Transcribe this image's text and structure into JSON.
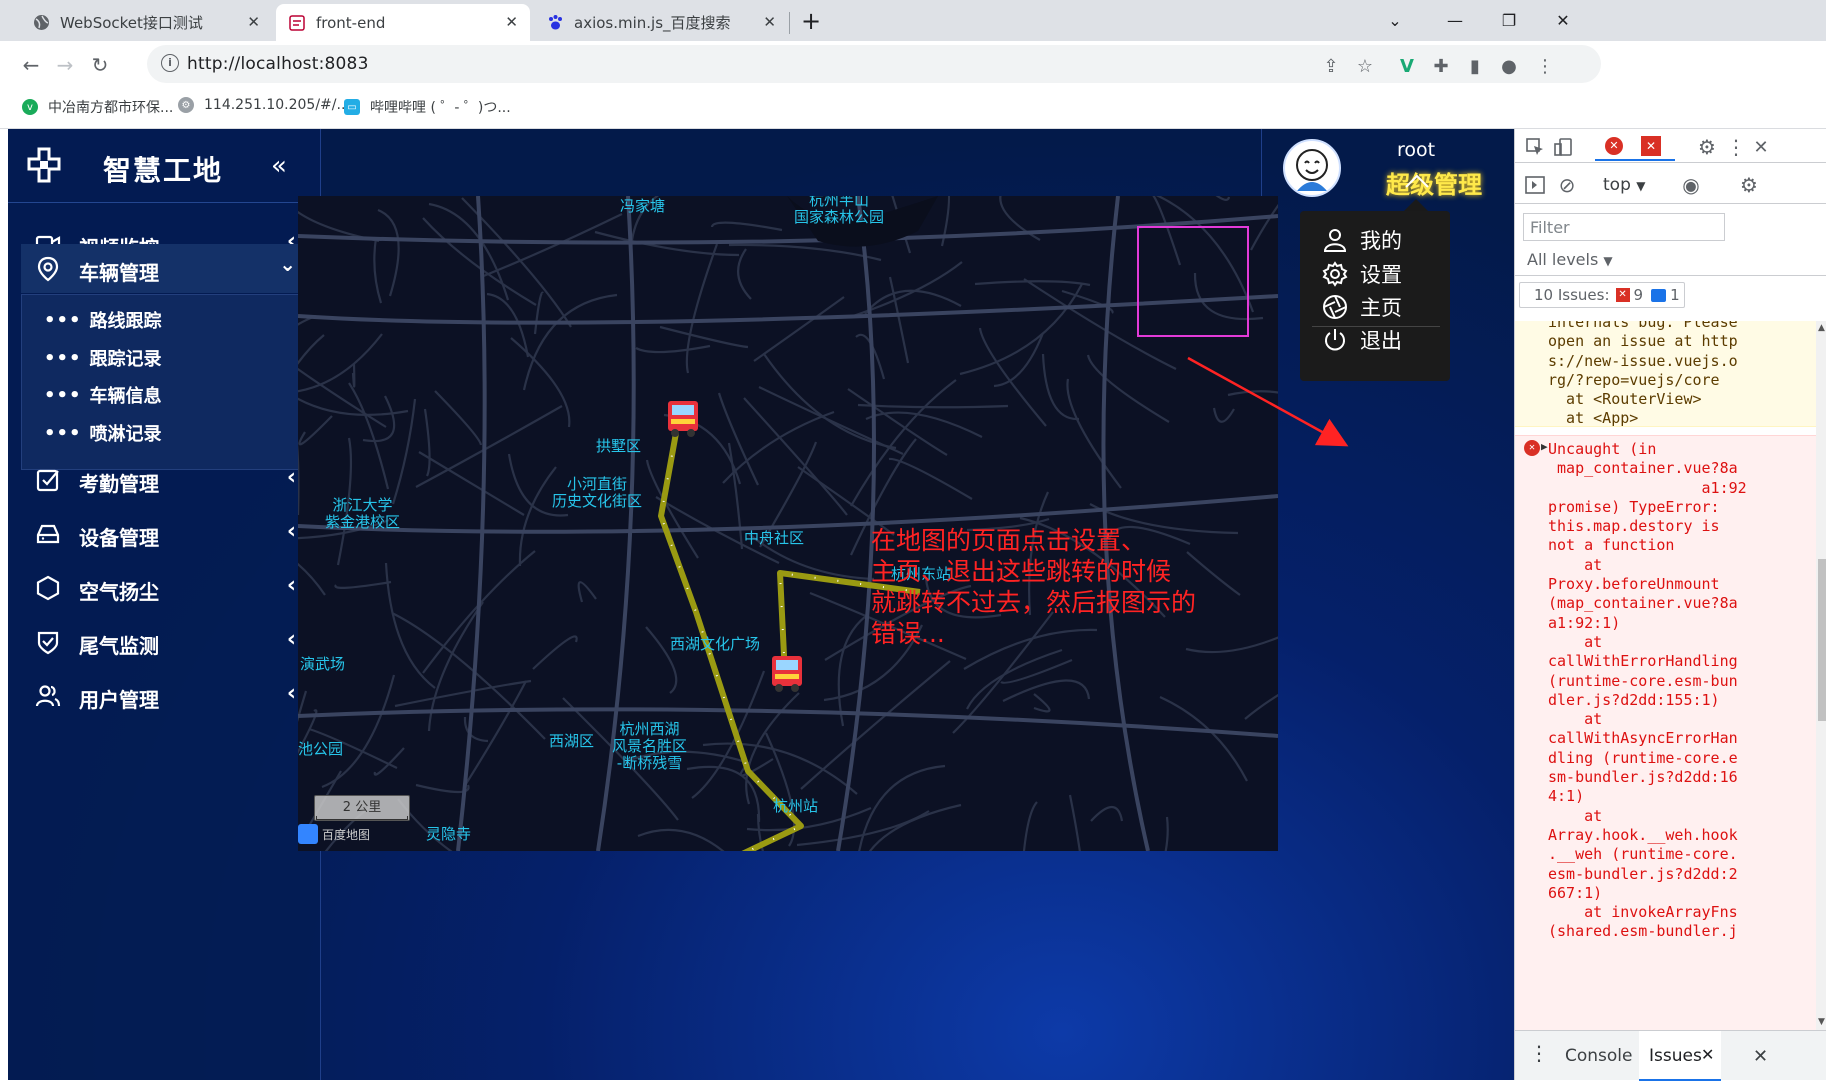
{
  "browser": {
    "tabs": [
      {
        "title": "WebSocket接口测试"
      },
      {
        "title": "front-end"
      },
      {
        "title": "axios.min.js_百度搜索"
      }
    ],
    "url": "http://localhost:8083",
    "bookmarks": [
      {
        "label": "中冶南方都市环保..."
      },
      {
        "label": "114.251.10.205/#/..."
      },
      {
        "label": "哔哩哔哩 ( ゜- ゜)つ..."
      }
    ]
  },
  "app": {
    "brand": "智慧工地",
    "menu": [
      {
        "label": "视频监控",
        "icon": "video-camera-icon"
      },
      {
        "label": "车辆管理",
        "icon": "location-pin-icon",
        "expanded": true
      },
      {
        "label": "考勤管理",
        "icon": "checkbox-icon"
      },
      {
        "label": "设备管理",
        "icon": "device-icon"
      },
      {
        "label": "空气扬尘",
        "icon": "hexagon-icon"
      },
      {
        "label": "尾气监测",
        "icon": "shield-check-icon"
      },
      {
        "label": "用户管理",
        "icon": "users-icon"
      }
    ],
    "submenu": [
      {
        "label": "路线跟踪"
      },
      {
        "label": "跟踪记录"
      },
      {
        "label": "车辆信息"
      },
      {
        "label": "喷淋记录"
      }
    ],
    "user": {
      "name": "root",
      "role": "超级管理"
    },
    "dropdown": [
      {
        "label": "我的",
        "icon": "user-icon"
      },
      {
        "label": "设置",
        "icon": "gear-icon"
      },
      {
        "label": "主页",
        "icon": "aperture-icon"
      },
      {
        "label": "退出",
        "icon": "power-icon"
      }
    ],
    "map": {
      "labels": [
        {
          "text": "冯家塘"
        },
        {
          "text": "杭州半山\n国家森林公园"
        },
        {
          "text": "拱墅区"
        },
        {
          "text": "小河直街\n历史文化街区"
        },
        {
          "text": "浙江大学\n紫金港校区"
        },
        {
          "text": "中舟社区"
        },
        {
          "text": "杭州东站"
        },
        {
          "text": "西湖文化广场"
        },
        {
          "text": "演武场"
        },
        {
          "text": "西湖区"
        },
        {
          "text": "杭州西湖\n风景名胜区\n-断桥残雪"
        },
        {
          "text": "池公园"
        },
        {
          "text": "杭州站"
        },
        {
          "text": "灵隐寺"
        }
      ],
      "scale": "2 公里",
      "copyright": "百度地图"
    },
    "annotation": "在地图的页面点击设置、\n主页、退出这些跳转的时候\n就跳转不过去，然后报图示的\n错误..."
  },
  "devtools": {
    "context": "top",
    "filter_placeholder": "Filter",
    "levels": "All levels",
    "issues_label": "10 Issues:",
    "issues_errors": "9",
    "issues_info": "1",
    "warn_text": "internals bug. Please\nopen an issue at http\ns://new-issue.vuejs.o\nrg/?repo=vuejs/core\n  at <RouterView>\n  at <App>",
    "error_text": "Uncaught (in\n map_container.vue?8a\n                 a1:92\npromise) TypeError:\nthis.map.destory is\nnot a function\n    at\nProxy.beforeUnmount\n(map_container.vue?8a\na1:92:1)\n    at\ncallWithErrorHandling\n(runtime-core.esm-bun\ndler.js?d2dd:155:1)\n    at\ncallWithAsyncErrorHan\ndling (runtime-core.e\nsm-bundler.js?d2dd:16\n4:1)\n    at\nArray.hook.__weh.hook\n.__weh (runtime-core.\nesm-bundler.js?d2dd:2\n667:1)\n    at invokeArrayFns\n(shared.esm-bundler.j",
    "bottom_tabs": [
      "Console",
      "Issues"
    ]
  },
  "colors": {
    "app_bg": "#031a4a",
    "role": "#ffe94a",
    "map_label": "#27c5ea",
    "route": "#9a9a12",
    "annotation": "#ff2323",
    "highlight": "#e23ad8",
    "error": "#d11"
  }
}
